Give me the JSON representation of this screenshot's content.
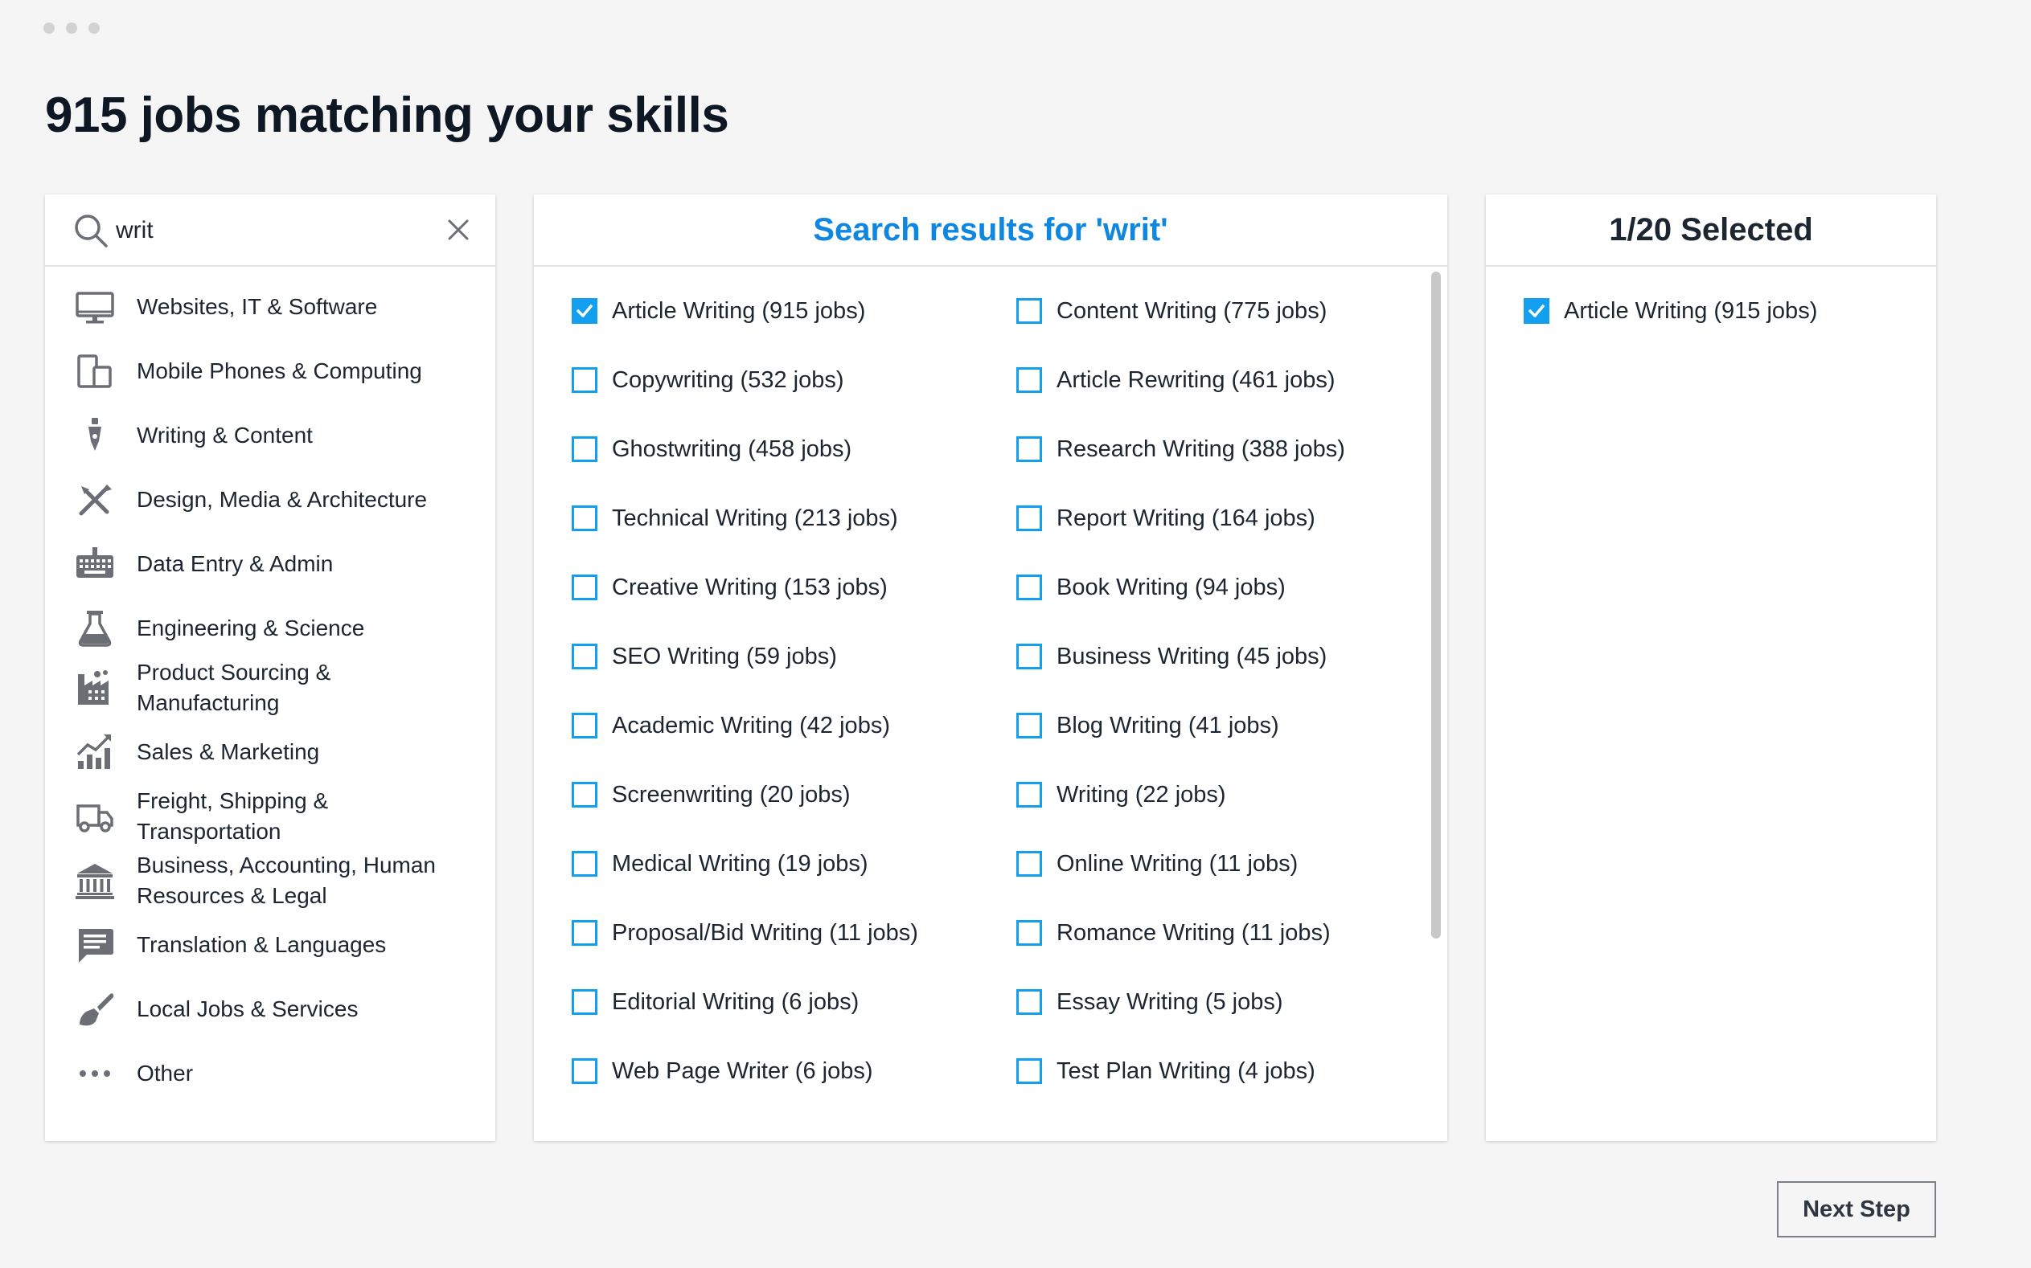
{
  "page": {
    "title": "915 jobs matching your skills"
  },
  "search": {
    "value": "writ"
  },
  "categories": [
    {
      "label": "Websites, IT & Software",
      "icon": "monitor-icon"
    },
    {
      "label": "Mobile Phones & Computing",
      "icon": "devices-icon"
    },
    {
      "label": "Writing & Content",
      "icon": "pen-nib-icon"
    },
    {
      "label": "Design, Media & Architecture",
      "icon": "design-tools-icon"
    },
    {
      "label": "Data Entry & Admin",
      "icon": "keyboard-icon"
    },
    {
      "label": "Engineering & Science",
      "icon": "flask-icon"
    },
    {
      "label": "Product Sourcing & Manufacturing",
      "icon": "factory-icon"
    },
    {
      "label": "Sales & Marketing",
      "icon": "bar-chart-icon"
    },
    {
      "label": "Freight, Shipping & Transportation",
      "icon": "truck-icon"
    },
    {
      "label": "Business, Accounting, Human Resources & Legal",
      "icon": "bank-icon"
    },
    {
      "label": "Translation & Languages",
      "icon": "message-icon"
    },
    {
      "label": "Local Jobs & Services",
      "icon": "brush-icon"
    },
    {
      "label": "Other",
      "icon": "more-dots-icon"
    }
  ],
  "results": {
    "header": "Search results for 'writ'",
    "left": [
      {
        "label": "Article Writing (915 jobs)",
        "checked": true
      },
      {
        "label": "Copywriting (532 jobs)",
        "checked": false
      },
      {
        "label": "Ghostwriting (458 jobs)",
        "checked": false
      },
      {
        "label": "Technical Writing (213 jobs)",
        "checked": false
      },
      {
        "label": "Creative Writing (153 jobs)",
        "checked": false
      },
      {
        "label": "SEO Writing (59 jobs)",
        "checked": false
      },
      {
        "label": "Academic Writing (42 jobs)",
        "checked": false
      },
      {
        "label": "Screenwriting (20 jobs)",
        "checked": false
      },
      {
        "label": "Medical Writing (19 jobs)",
        "checked": false
      },
      {
        "label": "Proposal/Bid Writing (11 jobs)",
        "checked": false
      },
      {
        "label": "Editorial Writing (6 jobs)",
        "checked": false
      },
      {
        "label": "Web Page Writer (6 jobs)",
        "checked": false
      }
    ],
    "right": [
      {
        "label": "Content Writing (775 jobs)",
        "checked": false
      },
      {
        "label": "Article Rewriting (461 jobs)",
        "checked": false
      },
      {
        "label": "Research Writing (388 jobs)",
        "checked": false
      },
      {
        "label": "Report Writing (164 jobs)",
        "checked": false
      },
      {
        "label": "Book Writing (94 jobs)",
        "checked": false
      },
      {
        "label": "Business Writing (45 jobs)",
        "checked": false
      },
      {
        "label": "Blog Writing (41 jobs)",
        "checked": false
      },
      {
        "label": "Writing (22 jobs)",
        "checked": false
      },
      {
        "label": "Online Writing (11 jobs)",
        "checked": false
      },
      {
        "label": "Romance Writing (11 jobs)",
        "checked": false
      },
      {
        "label": "Essay Writing (5 jobs)",
        "checked": false
      },
      {
        "label": "Test Plan Writing (4 jobs)",
        "checked": false
      }
    ]
  },
  "selected": {
    "header": "1/20 Selected",
    "items": [
      {
        "label": "Article Writing (915 jobs)",
        "checked": true
      }
    ]
  },
  "footer": {
    "next_label": "Next Step"
  },
  "colors": {
    "accent": "#139ff0",
    "header_blue": "#0f87e0",
    "icon_gray": "#6b6f75"
  }
}
